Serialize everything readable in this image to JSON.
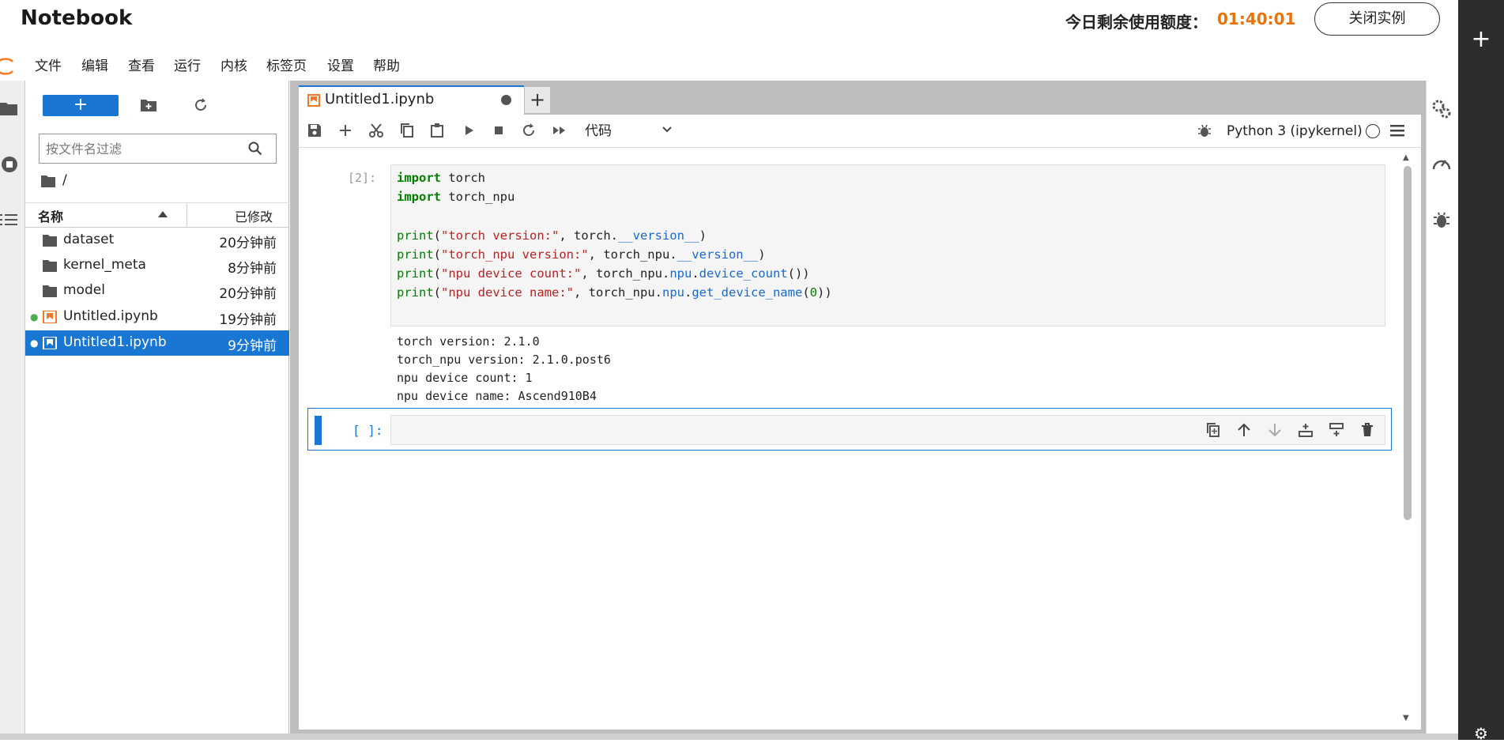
{
  "header": {
    "title": "Notebook",
    "quota_label": "今日剩余使用额度：",
    "quota_time": "01:40:01",
    "close_button": "关闭实例"
  },
  "menu": [
    "文件",
    "编辑",
    "查看",
    "运行",
    "内核",
    "标签页",
    "设置",
    "帮助"
  ],
  "filebrowser": {
    "new_button": "+",
    "filter_placeholder": "按文件名过滤",
    "breadcrumb": "/",
    "col_name": "名称",
    "col_modified": "已修改",
    "files": [
      {
        "name": "dataset",
        "modified": "20分钟前",
        "type": "folder"
      },
      {
        "name": "kernel_meta",
        "modified": "8分钟前",
        "type": "folder"
      },
      {
        "name": "model",
        "modified": "20分钟前",
        "type": "folder"
      },
      {
        "name": "Untitled.ipynb",
        "modified": "19分钟前",
        "type": "notebook",
        "running": true
      },
      {
        "name": "Untitled1.ipynb",
        "modified": "9分钟前",
        "type": "notebook",
        "running": true,
        "selected": true
      }
    ]
  },
  "notebook": {
    "tab_label": "Untitled1.ipynb",
    "cell_type": "代码",
    "kernel": "Python 3 (ipykernel)",
    "cell1_prompt": "[2]:",
    "cell1_output": "torch version: 2.1.0\ntorch_npu version: 2.1.0.post6\nnpu device count: 1\nnpu device name: Ascend910B4",
    "cell2_prompt": "[ ]:"
  },
  "colors": {
    "accent": "#1976d2",
    "quota": "#e8730a",
    "dark_strip": "#2d2d2d"
  }
}
